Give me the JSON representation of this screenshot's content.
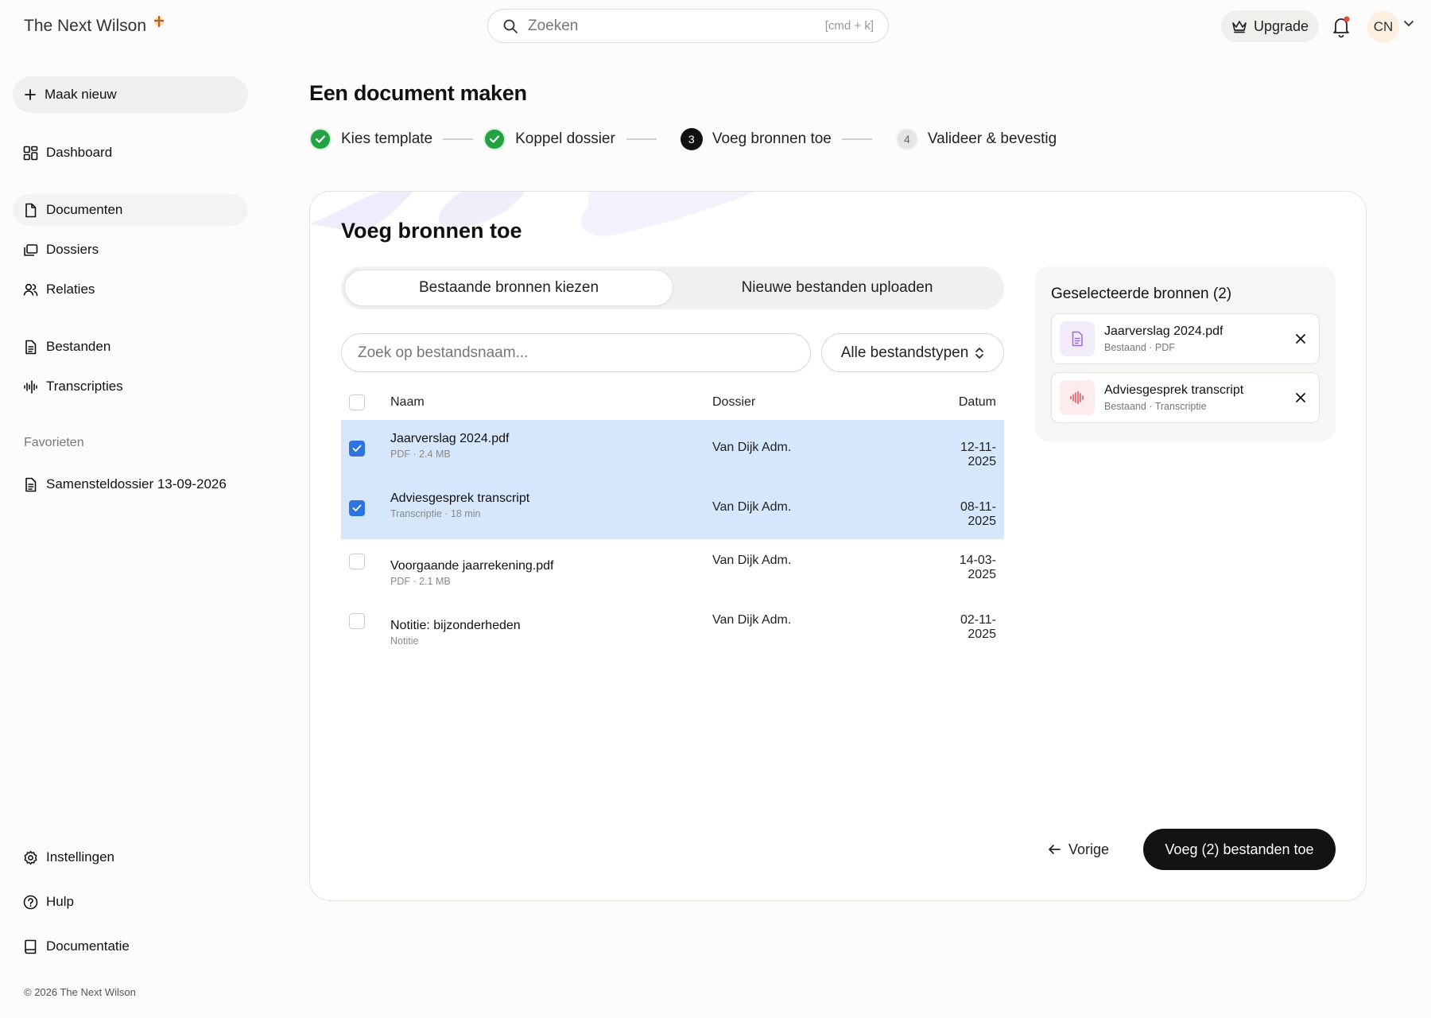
{
  "brand": {
    "name": "The Next Wilson"
  },
  "search": {
    "placeholder": "Zoeken",
    "shortcut": "[cmd + k]"
  },
  "header": {
    "upgrade_label": "Upgrade",
    "avatar_initials": "CN"
  },
  "sidebar": {
    "new_label": "Maak nieuw",
    "items": [
      {
        "label": "Dashboard",
        "icon": "dashboard-icon"
      },
      {
        "label": "Documenten",
        "icon": "document-icon",
        "active": true
      },
      {
        "label": "Dossiers",
        "icon": "folders-icon"
      },
      {
        "label": "Relaties",
        "icon": "users-icon"
      },
      {
        "label": "Bestanden",
        "icon": "file-text-icon"
      },
      {
        "label": "Transcripties",
        "icon": "audio-wave-icon"
      }
    ],
    "favorites_heading": "Favorieten",
    "favorites": [
      {
        "label": "Samensteldossier 13-09-2026",
        "icon": "file-text-icon"
      }
    ],
    "bottom": [
      {
        "label": "Instellingen",
        "icon": "gear-icon"
      },
      {
        "label": "Hulp",
        "icon": "help-icon"
      },
      {
        "label": "Documentatie",
        "icon": "book-icon"
      }
    ],
    "copyright": "© 2026 The Next Wilson"
  },
  "page": {
    "title": "Een document maken"
  },
  "stepper": [
    {
      "label": "Kies template",
      "state": "done",
      "number": "1"
    },
    {
      "label": "Koppel dossier",
      "state": "done",
      "number": "2"
    },
    {
      "label": "Voeg bronnen toe",
      "state": "current",
      "number": "3"
    },
    {
      "label": "Valideer & bevestig",
      "state": "todo",
      "number": "4"
    }
  ],
  "card": {
    "title": "Voeg bronnen toe",
    "tabs": [
      {
        "label": "Bestaande bronnen kiezen",
        "active": true
      },
      {
        "label": "Nieuwe bestanden uploaden",
        "active": false
      }
    ],
    "file_search_placeholder": "Zoek op bestandsnaam...",
    "type_filter": "Alle bestandstypen",
    "table": {
      "headers": {
        "name": "Naam",
        "dossier": "Dossier",
        "date": "Datum"
      },
      "rows": [
        {
          "name": "Jaarverslag 2024.pdf",
          "meta": "PDF · 2.4 MB",
          "dossier": "Van Dijk Adm.",
          "date": "12-11-2025",
          "checked": true
        },
        {
          "name": "Adviesgesprek transcript",
          "meta": "Transcriptie · 18 min",
          "dossier": "Van Dijk Adm.",
          "date": "08-11-2025",
          "checked": true
        },
        {
          "name": "Voorgaande jaarrekening.pdf",
          "meta": "PDF · 2.1 MB",
          "dossier": "Van Dijk Adm.",
          "date": "14-03-2025",
          "checked": false
        },
        {
          "name": "Notitie: bijzonderheden",
          "meta": "Notitie",
          "dossier": "Van Dijk Adm.",
          "date": "02-11-2025",
          "checked": false
        }
      ]
    },
    "selected": {
      "heading": "Geselecteerde bronnen (2)",
      "items": [
        {
          "name": "Jaarverslag 2024.pdf",
          "meta": "Bestaand · PDF",
          "icon": "pdf-file-icon"
        },
        {
          "name": "Adviesgesprek transcript",
          "meta": "Bestaand · Transcriptie",
          "icon": "audio-wave-icon"
        }
      ]
    },
    "back_label": "Vorige",
    "submit_label": "Voeg (2) bestanden toe"
  },
  "colors": {
    "accent_green": "#22a243",
    "selected_row": "#d7e7fb",
    "checkbox_blue": "#2d74e0",
    "primary_button": "#131313",
    "notification_dot": "#e5483b"
  }
}
